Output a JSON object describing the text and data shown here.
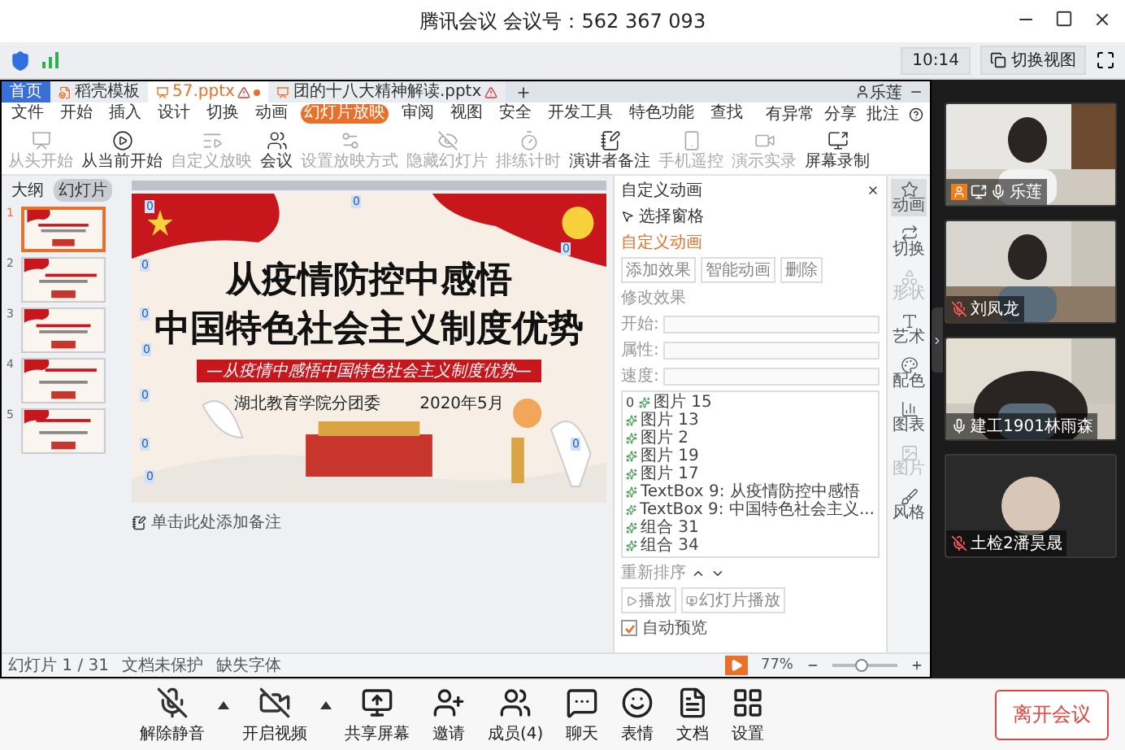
{
  "window": {
    "title": "腾讯会议 会议号：562 367 093"
  },
  "top_bar": {
    "time": "10:14",
    "switch_view": "切换视图"
  },
  "shared_screen": {
    "tabs": [
      {
        "label": "首页",
        "selected": false,
        "kind": "home"
      },
      {
        "label": "稻壳模板",
        "selected": false,
        "kind": "store"
      },
      {
        "label": "57.pptx",
        "selected": true,
        "kind": "doc",
        "warning": true,
        "modified": true
      },
      {
        "label": "团的十八大精神解读.pptx",
        "selected": false,
        "kind": "doc",
        "warning": true,
        "modified": false
      }
    ],
    "user": "乐莲",
    "file_menu": "文件",
    "menu": [
      {
        "label": "开始",
        "selected": false
      },
      {
        "label": "插入",
        "selected": false
      },
      {
        "label": "设计",
        "selected": false
      },
      {
        "label": "切换",
        "selected": false
      },
      {
        "label": "动画",
        "selected": false
      },
      {
        "label": "幻灯片放映",
        "selected": true
      },
      {
        "label": "审阅",
        "selected": false
      },
      {
        "label": "视图",
        "selected": false
      },
      {
        "label": "安全",
        "selected": false
      },
      {
        "label": "开发工具",
        "selected": false
      },
      {
        "label": "特色功能",
        "selected": false
      },
      {
        "label": "查找",
        "selected": false
      }
    ],
    "menu_right": [
      "有异常",
      "分享",
      "批注"
    ],
    "ribbon": [
      {
        "label": "从头开始",
        "disabled": true
      },
      {
        "label": "从当前开始",
        "disabled": false
      },
      {
        "label": "自定义放映",
        "disabled": true
      },
      {
        "label": "会议",
        "disabled": false
      },
      {
        "label": "设置放映方式",
        "disabled": true
      },
      {
        "label": "隐藏幻灯片",
        "disabled": true
      },
      {
        "label": "排练计时",
        "disabled": true
      },
      {
        "label": "演讲者备注",
        "disabled": false
      },
      {
        "label": "手机遥控",
        "disabled": true
      },
      {
        "label": "演示实录",
        "disabled": true
      },
      {
        "label": "屏幕录制",
        "disabled": false
      }
    ],
    "panel_tabs": [
      {
        "label": "大纲",
        "selected": false
      },
      {
        "label": "幻灯片",
        "selected": true
      }
    ],
    "thumbnails": [
      {
        "number": "1",
        "selected": true
      },
      {
        "number": "2",
        "selected": false
      },
      {
        "number": "3",
        "selected": false
      },
      {
        "number": "4",
        "selected": false
      },
      {
        "number": "5",
        "selected": false
      }
    ],
    "slide": {
      "title_lines": [
        "从疫情防控中感悟",
        "中国特色社会主义制度优势"
      ],
      "subtitle": "—从疫情中感悟中国特色社会主义制度优势—",
      "org": "湖北教育学院分团委",
      "date": "2020年5月",
      "tags": [
        "0",
        "0",
        "0",
        "0",
        "0",
        "0",
        "0",
        "0",
        "0",
        "0"
      ]
    },
    "notes_placeholder": "单击此处添加备注",
    "status": {
      "slide_count": "幻灯片 1 / 31",
      "protection": "文档未保护",
      "fonts": "缺失字体",
      "zoom": "77%",
      "level": 0.45
    },
    "animation_pane": {
      "title": "自定义动画",
      "selection_pane": "选择窗格",
      "heading": "自定义动画",
      "buttons": [
        "添加效果",
        "智能动画",
        "删除"
      ],
      "modify": "修改效果",
      "fields": [
        "开始:",
        "属性:",
        "速度:"
      ],
      "effects": [
        {
          "order": "0",
          "label": "图片 15"
        },
        {
          "label": "图片 13"
        },
        {
          "label": "图片 2"
        },
        {
          "label": "图片 19"
        },
        {
          "label": "图片 17"
        },
        {
          "label": "TextBox 9: 从疫情防控中感悟"
        },
        {
          "label": "TextBox 9: 中国特色社会主义..."
        },
        {
          "label": "组合 31"
        },
        {
          "label": "组合 34"
        }
      ],
      "reorder": "重新排序",
      "play": "播放",
      "slideshow": "幻灯片播放",
      "auto_preview": {
        "label": "自动预览",
        "checked": true
      }
    },
    "side_tools": [
      {
        "label": "动画",
        "selected": true,
        "disabled": false
      },
      {
        "label": "切换",
        "selected": false,
        "disabled": false
      },
      {
        "label": "形状",
        "selected": false,
        "disabled": true
      },
      {
        "label": "艺术",
        "selected": false,
        "disabled": false
      },
      {
        "label": "配色",
        "selected": false,
        "disabled": false
      },
      {
        "label": "图表",
        "selected": false,
        "disabled": false
      },
      {
        "label": "图片",
        "selected": false,
        "disabled": true
      },
      {
        "label": "风格",
        "selected": false,
        "disabled": false
      }
    ]
  },
  "participants": [
    {
      "name": "乐莲",
      "muted": false,
      "host": true,
      "sharing": true,
      "video": true
    },
    {
      "name": "刘凤龙",
      "muted": true,
      "host": false,
      "sharing": false,
      "video": true
    },
    {
      "name": "建工1901林雨森",
      "muted": false,
      "host": false,
      "sharing": false,
      "video": true
    },
    {
      "name": "土检2潘昊晟",
      "muted": true,
      "host": false,
      "sharing": false,
      "video": false
    }
  ],
  "toolbar": [
    {
      "label": "解除静音",
      "kind": "mic",
      "off": true,
      "has_menu": true
    },
    {
      "label": "开启视频",
      "kind": "video",
      "off": true,
      "has_menu": true
    },
    {
      "label": "共享屏幕",
      "kind": "share"
    },
    {
      "label": "邀请",
      "kind": "invite"
    },
    {
      "label": "成员(4)",
      "kind": "members"
    },
    {
      "label": "聊天",
      "kind": "chat"
    },
    {
      "label": "表情",
      "kind": "emoji"
    },
    {
      "label": "文档",
      "kind": "docs"
    },
    {
      "label": "设置",
      "kind": "settings"
    }
  ],
  "leave_button": "离开会议"
}
